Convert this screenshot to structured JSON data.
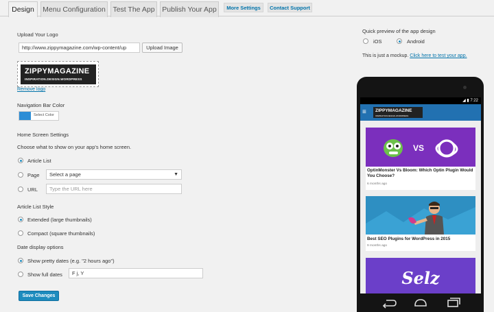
{
  "tabs": {
    "design": "Design",
    "menu_configuration": "Menu Configuration",
    "test_app": "Test The App",
    "publish": "Publish Your App",
    "more_settings": "More Settings",
    "contact_support": "Contact Support"
  },
  "logo_section": {
    "label": "Upload Your Logo",
    "url_value": "http://www.zippymagazine.com/wp-content/up",
    "upload_button": "Upload Image",
    "logo_text": "ZIPPYMAGAZINE",
    "logo_tagline": "INSPIRATION.DESIGN.WORDPRESS",
    "remove_link": "Remove logo"
  },
  "nav_color": {
    "label": "Navigation Bar Color",
    "button": "Select Color",
    "color": "#2c8dd6"
  },
  "home_screen": {
    "heading": "Home Screen Settings",
    "description": "Choose what to show on your app's home screen.",
    "options": {
      "article_list": "Article List",
      "page": "Page",
      "url": "URL"
    },
    "selected": "Article List",
    "page_select_value": "Select a page",
    "url_placeholder": "Type the URL here"
  },
  "article_style": {
    "heading": "Article List Style",
    "extended": "Extended (large thumbnails)",
    "compact": "Compact (square thumbnails)",
    "selected": "Extended (large thumbnails)"
  },
  "date_options": {
    "heading": "Date display options",
    "pretty": "Show pretty dates (e.g. \"2 hours ago\")",
    "full": "Show full dates",
    "format_value": "F j, Y",
    "selected": "Show pretty dates (e.g. \"2 hours ago\")"
  },
  "save_button": "Save Changes",
  "preview": {
    "heading": "Quick preview of the app design",
    "ios": "iOS",
    "android": "Android",
    "selected": "Android",
    "mockup_text": "This is just a mockup.",
    "test_link": "Click here to test your app.",
    "status_time": "7:22",
    "app_logo": "ZIPPYMAGAZINE",
    "app_logo_tagline": "INSPIRATION.DESIGN.WORDPRESS",
    "articles": [
      {
        "vs_text": "VS",
        "title": "OptinMonster Vs Bloom: Which Optin Plugin Would You Choose?",
        "ago": "6 months ago"
      },
      {
        "title": "Best SEO Plugins for WordPress in 2015",
        "ago": "9 months ago"
      },
      {
        "brand_text": "Selz"
      }
    ]
  },
  "colors": {
    "accent": "#1e8cbe",
    "app_bar": "#2271b1",
    "card1_bg": "#7b2fbd",
    "card3_bg": "#6b3fc9"
  }
}
